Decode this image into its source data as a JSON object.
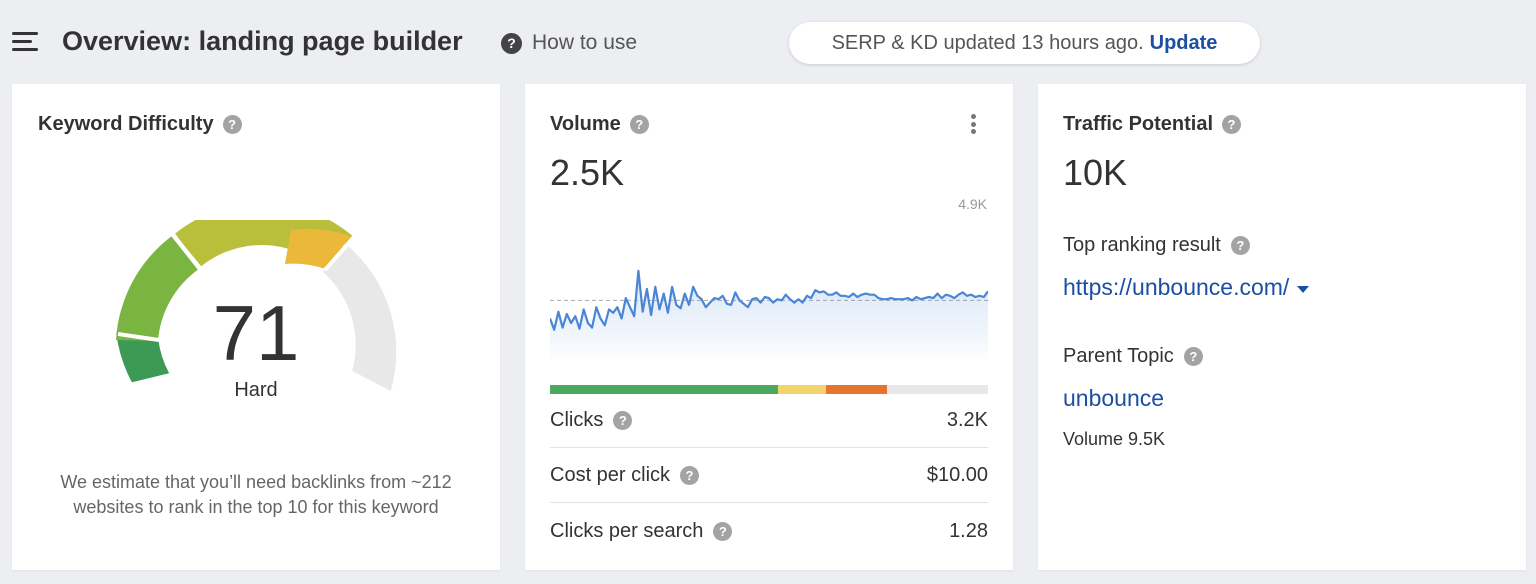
{
  "header": {
    "title": "Overview: landing page builder",
    "how_to_use": "How to use",
    "serp_status": "SERP & KD updated 13 hours ago.",
    "update_label": "Update"
  },
  "kd_card": {
    "title": "Keyword Difficulty",
    "value": "71",
    "level": "Hard",
    "description": "We estimate that you’ll need backlinks from ~212 websites to rank in the top 10 for this keyword"
  },
  "volume_card": {
    "title": "Volume",
    "value": "2.5K",
    "chart_max_label": "4.9K",
    "rows": [
      {
        "label": "Clicks",
        "value": "3.2K"
      },
      {
        "label": "Cost per click",
        "value": "$10.00"
      },
      {
        "label": "Clicks per search",
        "value": "1.28"
      }
    ]
  },
  "traffic_card": {
    "title": "Traffic Potential",
    "value": "10K",
    "top_ranking_label": "Top ranking result",
    "top_ranking_url": "https://unbounce.com/",
    "parent_topic_label": "Parent Topic",
    "parent_topic": "unbounce",
    "parent_volume": "Volume 9.5K"
  },
  "colors": {
    "link": "#1c4fa3",
    "chart_line": "#4a86d4",
    "gauge_segments": [
      "#3d9a55",
      "#7ab542",
      "#b9bf3a",
      "#eab93a",
      "#e8e8e8"
    ],
    "click_bar": [
      "#4caa5e",
      "#f3d36b",
      "#e5742c",
      "#e8e8e8"
    ]
  },
  "click_distribution": [
    0.52,
    0.11,
    0.14,
    0.23
  ],
  "chart_data": {
    "type": "area",
    "ymax": 4900,
    "average": 2500,
    "values": [
      1700,
      1200,
      2000,
      1300,
      1900,
      1500,
      1800,
      1250,
      2100,
      1500,
      1300,
      2200,
      1700,
      1400,
      2100,
      1950,
      2200,
      1700,
      2600,
      2200,
      1800,
      3800,
      2000,
      3000,
      1850,
      3100,
      2100,
      2800,
      1950,
      3100,
      2300,
      2150,
      2800,
      2300,
      3100,
      2700,
      2550,
      2200,
      2400,
      2600,
      2550,
      2700,
      2350,
      2300,
      2850,
      2500,
      2350,
      2200,
      2550,
      2600,
      2400,
      2650,
      2600,
      2400,
      2550,
      2500,
      2750,
      2550,
      2400,
      2550,
      2400,
      2700,
      2600,
      2950,
      2850,
      2900,
      2750,
      2750,
      2850,
      2700,
      2700,
      2650,
      2800,
      2650,
      2750,
      2800,
      2750,
      2750,
      2600,
      2550,
      2550,
      2600,
      2550,
      2550,
      2550,
      2600,
      2500,
      2650,
      2550,
      2600,
      2650,
      2600,
      2800,
      2600,
      2750,
      2700,
      2600,
      2750,
      2850,
      2700,
      2750,
      2650,
      2700,
      2650,
      2900
    ]
  }
}
